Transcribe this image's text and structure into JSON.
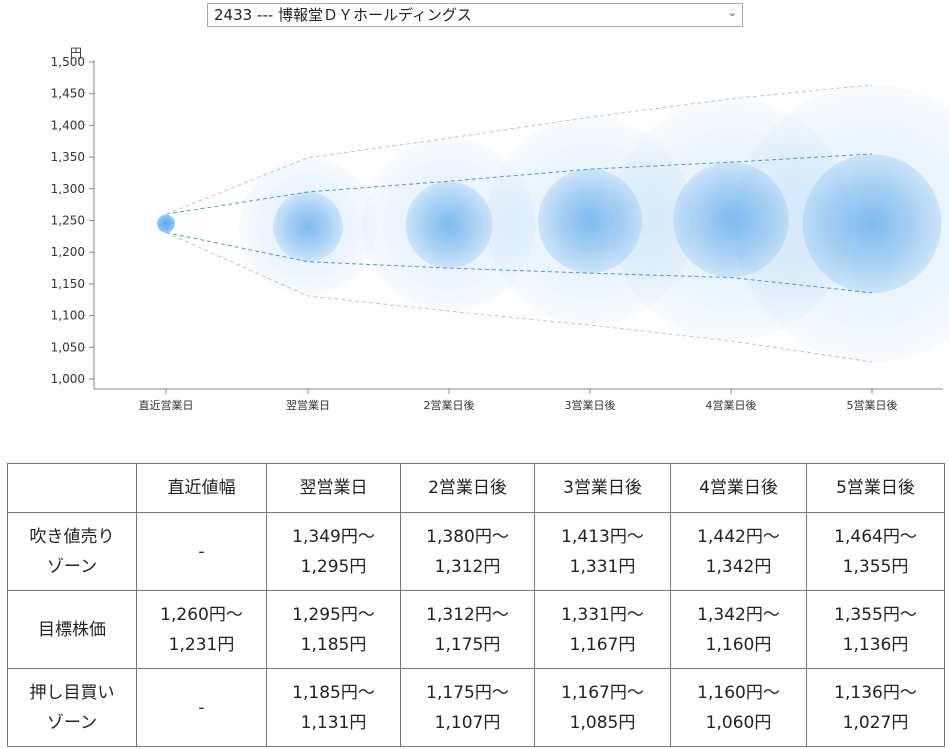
{
  "selector": {
    "value": "2433 --- 博報堂ＤＹホールディングス"
  },
  "chart_data": {
    "type": "scatter",
    "ylabel": "円",
    "ylim": [
      1000,
      1500
    ],
    "yticks": [
      1000,
      1050,
      1100,
      1150,
      1200,
      1250,
      1300,
      1350,
      1400,
      1450,
      1500
    ],
    "ytick_labels": [
      "1,000",
      "1,050",
      "1,100",
      "1,150",
      "1,200",
      "1,250",
      "1,300",
      "1,350",
      "1,400",
      "1,450",
      "1,500"
    ],
    "categories": [
      "直近営業日",
      "翌営業日",
      "2営業日後",
      "3営業日後",
      "4営業日後",
      "5営業日後"
    ],
    "target_center": [
      1245,
      1240,
      1243,
      1249,
      1251,
      1245
    ],
    "target_range": [
      [
        1231,
        1260
      ],
      [
        1185,
        1295
      ],
      [
        1175,
        1312
      ],
      [
        1167,
        1331
      ],
      [
        1160,
        1342
      ],
      [
        1136,
        1355
      ]
    ],
    "outer_range": [
      [
        1231,
        1260
      ],
      [
        1131,
        1349
      ],
      [
        1107,
        1380
      ],
      [
        1085,
        1413
      ],
      [
        1060,
        1442
      ],
      [
        1027,
        1464
      ]
    ],
    "grid": false,
    "bubble_color": "#1e88e5"
  },
  "table": {
    "headers": [
      "",
      "直近値幅",
      "翌営業日",
      "2営業日後",
      "3営業日後",
      "4営業日後",
      "5営業日後"
    ],
    "rows": [
      {
        "label": [
          "吹き値売り",
          "ゾーン"
        ],
        "cells": [
          [
            "-"
          ],
          [
            "1,349円～",
            "1,295円"
          ],
          [
            "1,380円～",
            "1,312円"
          ],
          [
            "1,413円～",
            "1,331円"
          ],
          [
            "1,442円～",
            "1,342円"
          ],
          [
            "1,464円～",
            "1,355円"
          ]
        ]
      },
      {
        "label": [
          "目標株価"
        ],
        "cells": [
          [
            "1,260円～",
            "1,231円"
          ],
          [
            "1,295円～",
            "1,185円"
          ],
          [
            "1,312円～",
            "1,175円"
          ],
          [
            "1,331円～",
            "1,167円"
          ],
          [
            "1,342円～",
            "1,160円"
          ],
          [
            "1,355円～",
            "1,136円"
          ]
        ]
      },
      {
        "label": [
          "押し目買い",
          "ゾーン"
        ],
        "cells": [
          [
            "-"
          ],
          [
            "1,185円～",
            "1,131円"
          ],
          [
            "1,175円～",
            "1,107円"
          ],
          [
            "1,167円～",
            "1,085円"
          ],
          [
            "1,160円～",
            "1,060円"
          ],
          [
            "1,136円～",
            "1,027円"
          ]
        ]
      }
    ]
  }
}
